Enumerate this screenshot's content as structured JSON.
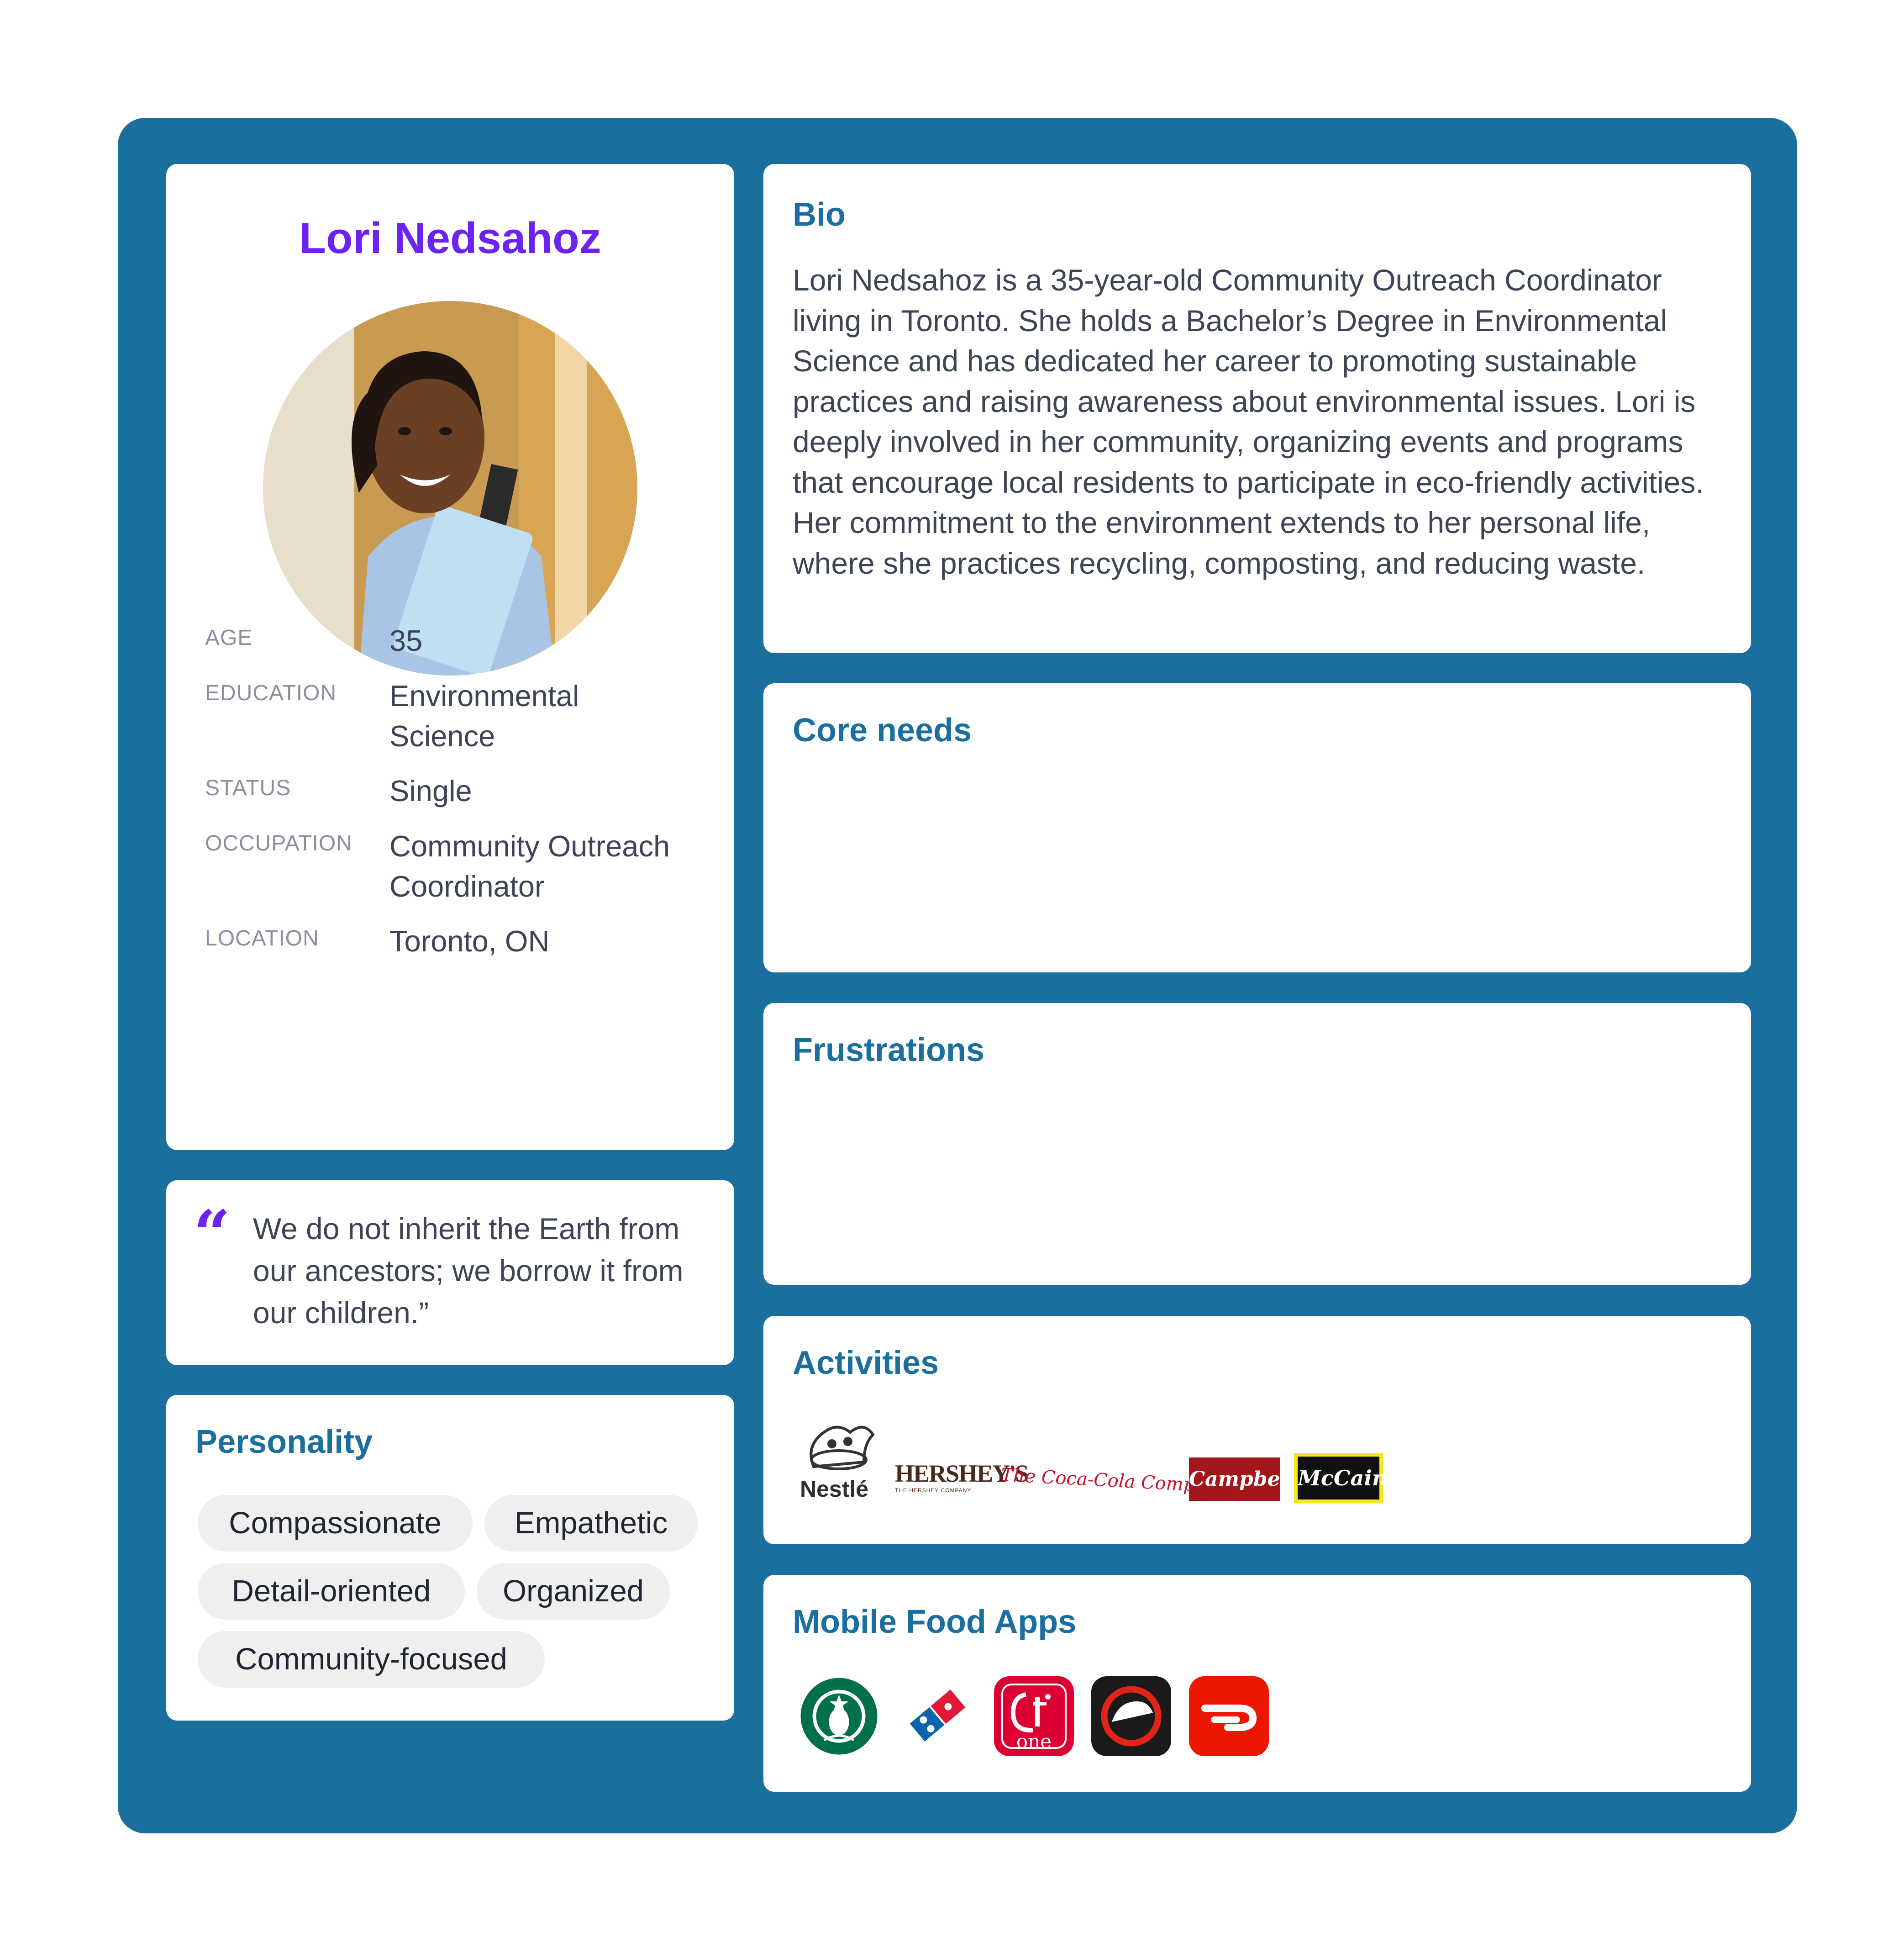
{
  "profile": {
    "name": "Lori Nedsahoz",
    "fields": [
      {
        "label": "AGE",
        "value": "35"
      },
      {
        "label": "EDUCATION",
        "value": "Environmental Science"
      },
      {
        "label": "STATUS",
        "value": "Single"
      },
      {
        "label": "OCCUPATION",
        "value": "Community Outreach Coordinator"
      },
      {
        "label": "LOCATION",
        "value": "Toronto, ON"
      }
    ]
  },
  "quote": {
    "mark": "“",
    "text": "We do not inherit the Earth from our ancestors; we borrow it from our children.”"
  },
  "personality": {
    "title": "Personality",
    "traits": [
      "Compassionate",
      "Empathetic",
      "Detail-oriented",
      "Organized",
      "Community-focused"
    ]
  },
  "bio": {
    "title": "Bio",
    "text": "Lori Nedsahoz is a 35-year-old Community Outreach Coordinator living in Toronto. She holds a Bachelor’s Degree in Environmental Science and has dedicated her career to promoting sustainable practices and raising awareness about environmental issues. Lori is deeply involved in her community, organizing events and programs that encourage local residents to participate in eco-friendly activities. Her commitment to the environment extends to her personal life, where she practices recycling, composting, and reducing waste."
  },
  "core_needs": {
    "title": "Core needs"
  },
  "frustrations": {
    "title": "Frustrations"
  },
  "activities": {
    "title": "Activities",
    "brands": [
      {
        "icon": "nestle-logo",
        "text": "Nestlé"
      },
      {
        "icon": "hershey-logo",
        "text": "HERSHEY'S",
        "subtext": "THE HERSHEY COMPANY"
      },
      {
        "icon": "coca-cola-company-logo",
        "text": "The Coca-Cola Company"
      },
      {
        "icon": "campbells-logo",
        "text": "Campbell's"
      },
      {
        "icon": "mccain-logo",
        "text": "McCain"
      }
    ]
  },
  "mobile_food_apps": {
    "title": "Mobile Food Apps",
    "apps": [
      {
        "icon": "starbucks-app-icon"
      },
      {
        "icon": "dominos-app-icon"
      },
      {
        "icon": "chick-fil-a-one-app-icon",
        "text": "one"
      },
      {
        "icon": "pizza-hut-app-icon"
      },
      {
        "icon": "doordash-app-icon"
      }
    ]
  },
  "colors": {
    "frame": "#1b6f9f",
    "accent_purple": "#6b22f2",
    "section_title": "#1b6f9f",
    "chip_bg": "#efefef"
  }
}
